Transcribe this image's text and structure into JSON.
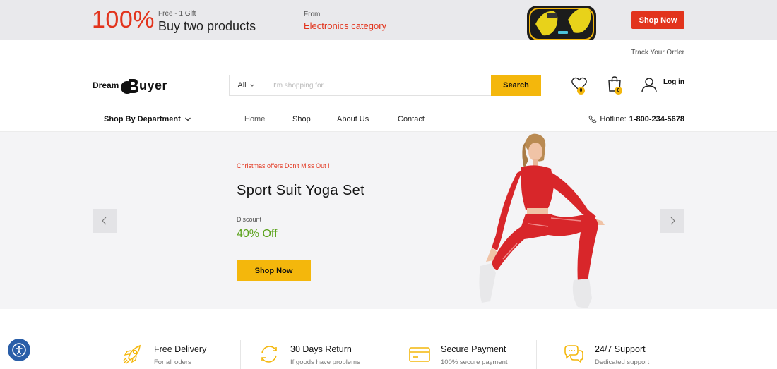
{
  "promo": {
    "percent": "100%",
    "gift_small": "Free - 1 Gift",
    "gift_big": "Buy two products",
    "from_small": "From",
    "from_big": "Electronics category",
    "shop_label": "Shop Now"
  },
  "topbar": {
    "track_label": "Track Your Order"
  },
  "header": {
    "logo_part1": "Dream",
    "logo_part2": "uyer",
    "search_category": "All",
    "search_placeholder": "I'm shopping for...",
    "search_button": "Search",
    "wishlist_count": "0",
    "cart_count": "0",
    "login_label": "Log in"
  },
  "nav": {
    "department_label": "Shop By Department",
    "links": [
      "Home",
      "Shop",
      "About Us",
      "Contact"
    ],
    "hotline_label": "Hotline:",
    "hotline_number": "1-800-234-5678"
  },
  "hero": {
    "tag": "Christmas offers Don't Miss Out !",
    "title": "Sport Suit Yoga Set",
    "discount_label": "Discount",
    "discount_value": "40% Off",
    "button": "Shop Now"
  },
  "features": [
    {
      "title": "Free Delivery",
      "subtitle": "For all oders",
      "icon": "rocket-icon"
    },
    {
      "title": "30 Days Return",
      "subtitle": "If goods have problems",
      "icon": "return-icon"
    },
    {
      "title": "Secure Payment",
      "subtitle": "100% secure payment",
      "icon": "credit-card-icon"
    },
    {
      "title": "24/7 Support",
      "subtitle": "Dedicated support",
      "icon": "chat-icon"
    }
  ],
  "colors": {
    "accent": "#f4b70c",
    "red": "#e2341d",
    "green": "#5aa21a"
  }
}
